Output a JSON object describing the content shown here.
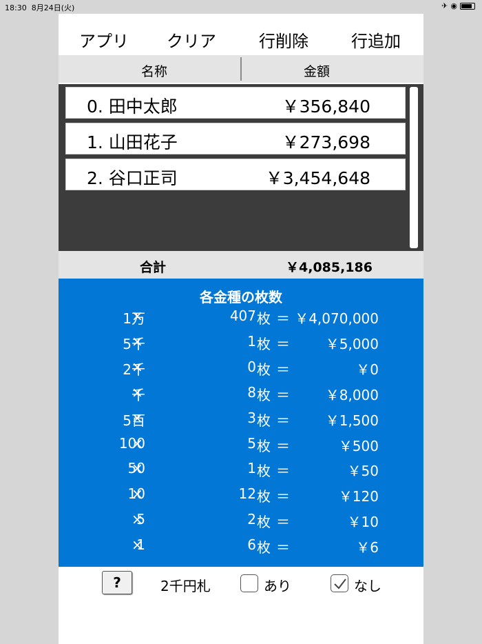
{
  "status": {
    "time": "18:30",
    "date": "8月24日(火)"
  },
  "toolbar": {
    "app": "アプリ",
    "clear": "クリア",
    "delete_row": "行削除",
    "add_row": "行追加"
  },
  "columns": {
    "name": "名称",
    "amount": "金額"
  },
  "entries": [
    {
      "label": "0. 田中太郎",
      "amount": "￥356,840"
    },
    {
      "label": "1. 山田花子",
      "amount": "￥273,698"
    },
    {
      "label": "2. 谷口正司",
      "amount": "￥3,454,648"
    }
  ],
  "total": {
    "label": "合計",
    "value": "￥4,085,186"
  },
  "denominations": {
    "title": "各金種の枚数",
    "times": "×",
    "unit": "枚",
    "equals": "＝",
    "rows": [
      {
        "name": "1万",
        "count": "407",
        "amount": "￥4,070,000"
      },
      {
        "name": "5千",
        "count": "1",
        "amount": "￥5,000"
      },
      {
        "name": "2千",
        "count": "0",
        "amount": "￥0"
      },
      {
        "name": "千",
        "count": "8",
        "amount": "￥8,000"
      },
      {
        "name": "5百",
        "count": "3",
        "amount": "￥1,500"
      },
      {
        "name": "100",
        "count": "5",
        "amount": "￥500"
      },
      {
        "name": "50",
        "count": "1",
        "amount": "￥50"
      },
      {
        "name": "10",
        "count": "12",
        "amount": "￥120"
      },
      {
        "name": "5",
        "count": "2",
        "amount": "￥10"
      },
      {
        "name": "1",
        "count": "6",
        "amount": "￥6"
      }
    ]
  },
  "footer": {
    "help": "?",
    "bill_2000_label": "2千円札",
    "option_yes": "あり",
    "option_no": "なし",
    "selected": "なし"
  },
  "colors": {
    "denominations_bg": "#0277d6",
    "list_bg": "#3c3c3c",
    "header_bg": "#e4e4e4"
  }
}
